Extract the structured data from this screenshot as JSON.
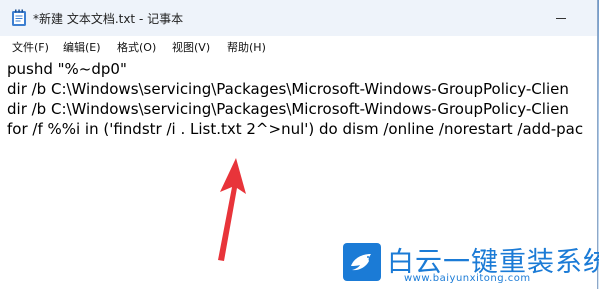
{
  "window": {
    "title": "*新建 文本文档.txt - 记事本"
  },
  "menu": {
    "items": [
      {
        "label": "文件(F)"
      },
      {
        "label": "编辑(E)"
      },
      {
        "label": "格式(O)"
      },
      {
        "label": "视图(V)"
      },
      {
        "label": "帮助(H)"
      }
    ]
  },
  "editor": {
    "lines": [
      "pushd \"%~dp0\"",
      "dir /b C:\\Windows\\servicing\\Packages\\Microsoft-Windows-GroupPolicy-Clien",
      "dir /b C:\\Windows\\servicing\\Packages\\Microsoft-Windows-GroupPolicy-Clien",
      "for /f %%i in ('findstr /i . List.txt 2^>nul') do dism /online /norestart /add-pac"
    ]
  },
  "annotation": {
    "color": "#e8343a"
  },
  "watermark": {
    "title": "白云一键重装系统",
    "url": "www.baiyunxitong.com",
    "color": "#1b7bd6"
  }
}
